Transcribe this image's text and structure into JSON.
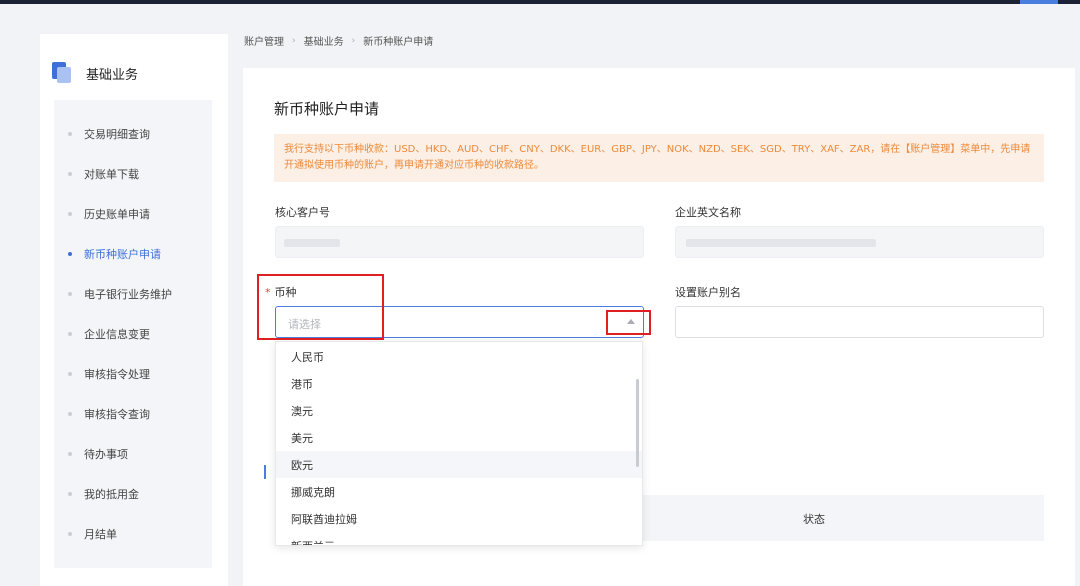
{
  "sidebar": {
    "title": "基础业务",
    "items": [
      {
        "label": "交易明细查询"
      },
      {
        "label": "对账单下载"
      },
      {
        "label": "历史账单申请"
      },
      {
        "label": "新币种账户申请",
        "active": true
      },
      {
        "label": "电子银行业务维护"
      },
      {
        "label": "企业信息变更"
      },
      {
        "label": "审核指令处理"
      },
      {
        "label": "审核指令查询"
      },
      {
        "label": "待办事项"
      },
      {
        "label": "我的抵用金"
      },
      {
        "label": "月结单"
      }
    ]
  },
  "breadcrumb": [
    "账户管理",
    "基础业务",
    "新币种账户申请"
  ],
  "page": {
    "title": "新币种账户申请",
    "notice": "我行支持以下币种收款：USD、HKD、AUD、CHF、CNY、DKK、EUR、GBP、JPY、NOK、NZD、SEK、SGD、TRY、XAF、ZAR，请在【账户管理】菜单中，先申请开通拟使用币种的账户，再申请开通对应币种的收款路径。"
  },
  "form": {
    "customer_no_label": "核心客户号",
    "company_en_name_label": "企业英文名称",
    "currency_label": "币种",
    "currency_required_mark": "*",
    "currency_placeholder": "请选择",
    "alias_label": "设置账户别名"
  },
  "table": {
    "status_header": "状态"
  },
  "dropdown": {
    "options": [
      "人民币",
      "港币",
      "澳元",
      "美元",
      "欧元",
      "挪威克朗",
      "阿联酋迪拉姆",
      "新西兰元"
    ],
    "hover_index": 4
  },
  "colors": {
    "accent": "#3f6fd9",
    "notice_bg": "#fcefe5",
    "notice_text": "#ec8a3a",
    "annotation": "#e02020"
  }
}
